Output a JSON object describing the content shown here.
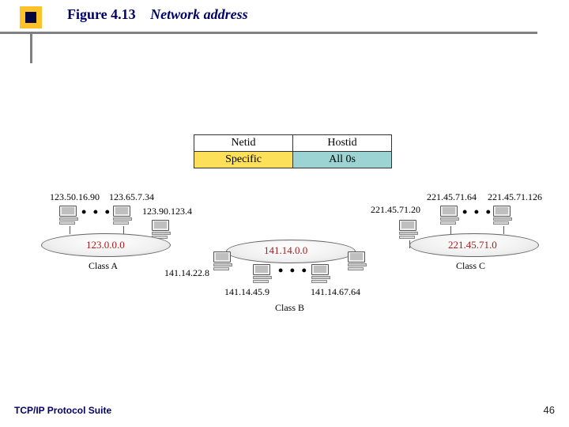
{
  "header": {
    "figure_label": "Figure 4.13",
    "figure_title": "Network address"
  },
  "table": {
    "row1": {
      "left": "Netid",
      "right": "Hostid"
    },
    "row2": {
      "left": "Specific",
      "right": "All 0s"
    }
  },
  "netA": {
    "hosts": [
      "123.50.16.90",
      "123.65.7.34",
      "123.90.123.4"
    ],
    "network": "123.0.0.0",
    "class_label": "Class A"
  },
  "netB": {
    "hosts": [
      "141.14.22.8",
      "141.14.45.9",
      "141.14.67.64"
    ],
    "network": "141.14.0.0",
    "class_label": "Class B"
  },
  "netC": {
    "hosts": [
      "221.45.71.20",
      "221.45.71.64",
      "221.45.71.126"
    ],
    "network": "221.45.71.0",
    "class_label": "Class C"
  },
  "footer": {
    "left": "TCP/IP Protocol Suite",
    "page": "46"
  },
  "glyphs": {
    "dots": "• • •"
  }
}
